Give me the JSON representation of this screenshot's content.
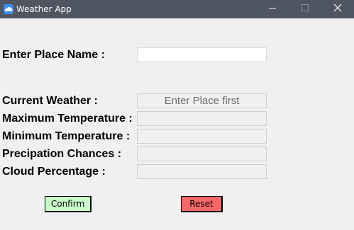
{
  "window": {
    "title": "Weather App",
    "icon": "weather-app-icon",
    "controls": [
      "minimize-icon",
      "maximize-icon",
      "close-icon"
    ]
  },
  "form": {
    "place_label": "Enter Place Name :",
    "place_value": "",
    "current_weather_label": "Current Weather :",
    "current_weather_value": "Enter Place first",
    "max_temp_label": "Maximum Temperature :",
    "max_temp_value": "",
    "min_temp_label": "Minimum Temperature :",
    "min_temp_value": "",
    "precip_label": "Precipation Chances :",
    "precip_value": "",
    "cloud_label": "Cloud Percentage :",
    "cloud_value": ""
  },
  "buttons": {
    "confirm_label": "Confirm",
    "confirm_color": "#c9fcc9",
    "reset_label": "Reset",
    "reset_color": "#f96868"
  }
}
